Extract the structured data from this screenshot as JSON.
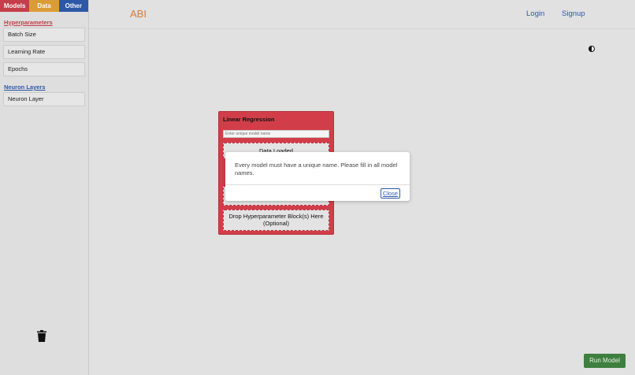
{
  "sidebar": {
    "tabs": [
      {
        "label": "Models",
        "color": "#c8414b"
      },
      {
        "label": "Data",
        "color": "#e0a03a"
      },
      {
        "label": "Other",
        "color": "#2e5aac"
      }
    ],
    "hyperparameters_heading": "Hyperparameters",
    "hyperparameter_blocks": [
      "Batch Size",
      "Learning Rate",
      "Epochs"
    ],
    "neuron_layers_heading": "Neuron Layers",
    "neuron_layer_blocks": [
      "Neuron Layer"
    ],
    "trash_icon": "trash-icon"
  },
  "header": {
    "logo": "ABI",
    "login": "Login",
    "signup": "Signup",
    "theme_icon": "contrast-icon"
  },
  "model_card": {
    "title": "Linear Regression",
    "name_placeholder": "Enter unique model name",
    "data_drop": "Data Loaded",
    "layer_drop": "",
    "hyper_drop": "Drop Hyperparameter Block(s) Here (Optional)"
  },
  "modal": {
    "message": "Every model must have a unique name. Please fill in all model names.",
    "close_label": "Close"
  },
  "run_button": "Run Model",
  "colors": {
    "accent_red": "#c8414b",
    "accent_orange": "#e0a03a",
    "accent_blue": "#2e5aac",
    "run_green": "#3f7f3f"
  }
}
